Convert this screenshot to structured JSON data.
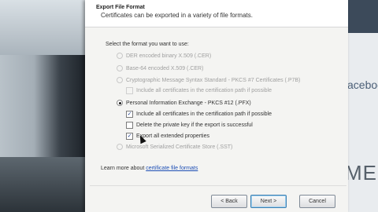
{
  "dialog": {
    "title": "Export File Format",
    "subtitle": "Certificates can be exported in a variety of file formats.",
    "prompt": "Select the format you want to use:",
    "formats": [
      {
        "label": "DER encoded binary X.509 (.CER)"
      },
      {
        "label": "Base-64 encoded X.509 (.CER)"
      },
      {
        "label": "Cryptographic Message Syntax Standard - PKCS #7 Certificates (.P7B)"
      },
      {
        "label": "Include all certificates in the certification path if possible"
      },
      {
        "label": "Personal Information Exchange - PKCS #12 (.PFX)"
      },
      {
        "label": "Include all certificates in the certification path if possible"
      },
      {
        "label": "Delete the private key if the export is successful"
      },
      {
        "label": "Export all extended properties"
      },
      {
        "label": "Microsoft Serialized Certificate Store (.SST)"
      }
    ],
    "learn_more_prefix": "Learn more about ",
    "learn_more_link": "certificate file formats",
    "buttons": {
      "back": "< Back",
      "next": "Next >",
      "cancel": "Cancel"
    }
  },
  "background": {
    "right_text_1": "acebook",
    "right_text_2": "MER"
  }
}
